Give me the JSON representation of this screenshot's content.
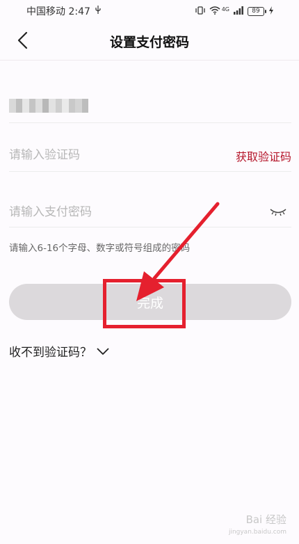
{
  "status_bar": {
    "carrier_time": "中国移动 2:47",
    "network": "4G",
    "battery": "89"
  },
  "header": {
    "title": "设置支付密码"
  },
  "form": {
    "code_placeholder": "请输入验证码",
    "get_code_label": "获取验证码",
    "password_placeholder": "请输入支付密码",
    "password_hint": "请输入6-16个字母、数字或符号组成的密码",
    "done_label": "完成",
    "no_code_label": "收不到验证码？"
  },
  "watermark": {
    "text": "Bai 经验",
    "url": "jingyan.baidu.com"
  },
  "colors": {
    "accent": "#b5162a",
    "annotation": "#e5202e",
    "button_disabled": "#dcd9dc"
  }
}
